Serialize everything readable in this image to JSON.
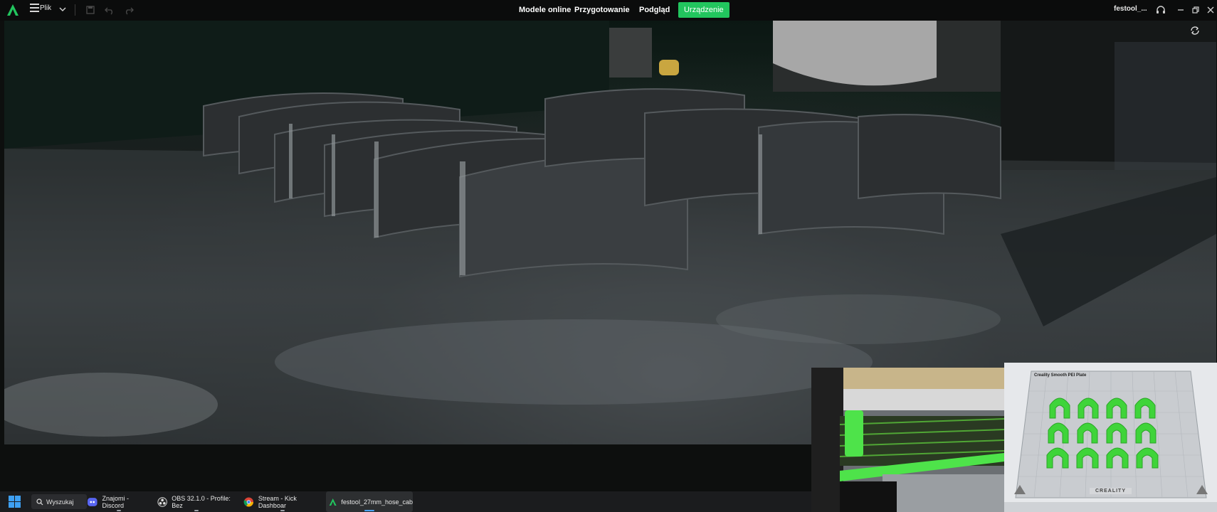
{
  "app": {
    "file_menu_label": "Plik",
    "nav_tabs": [
      "Modele online",
      "Przygotowanie",
      "Podgląd",
      "Urządzenie"
    ],
    "active_tab": "Urządzenie",
    "file_name": "festool_...",
    "accent_color": "#22c55e"
  },
  "slicer_inset": {
    "plate_label": "Creality Smooth PEI Plate",
    "brand_label": "CREALITY"
  },
  "taskbar": {
    "search_label": "Wyszukaj",
    "items": [
      {
        "label": "Znajomi - Discord",
        "icon": "discord-icon"
      },
      {
        "label": "OBS 32.1.0 - Profile: Bez",
        "icon": "obs-icon"
      },
      {
        "label": "Stream - Kick Dashboar",
        "icon": "chrome-icon"
      },
      {
        "label": "festool_27mm_hose_cab",
        "icon": "creality-print-icon"
      }
    ]
  }
}
